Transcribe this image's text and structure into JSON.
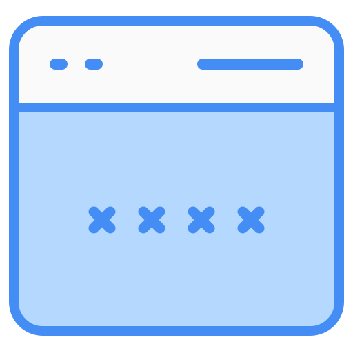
{
  "icon": {
    "name": "password-window-icon",
    "colors": {
      "stroke": "#448DF5",
      "header_fill": "#FAFAFA",
      "body_fill": "#B5D8FE"
    },
    "window_controls": [
      "dot-control",
      "dot-control"
    ],
    "address_bar": "line",
    "password_mask_count": 4
  }
}
